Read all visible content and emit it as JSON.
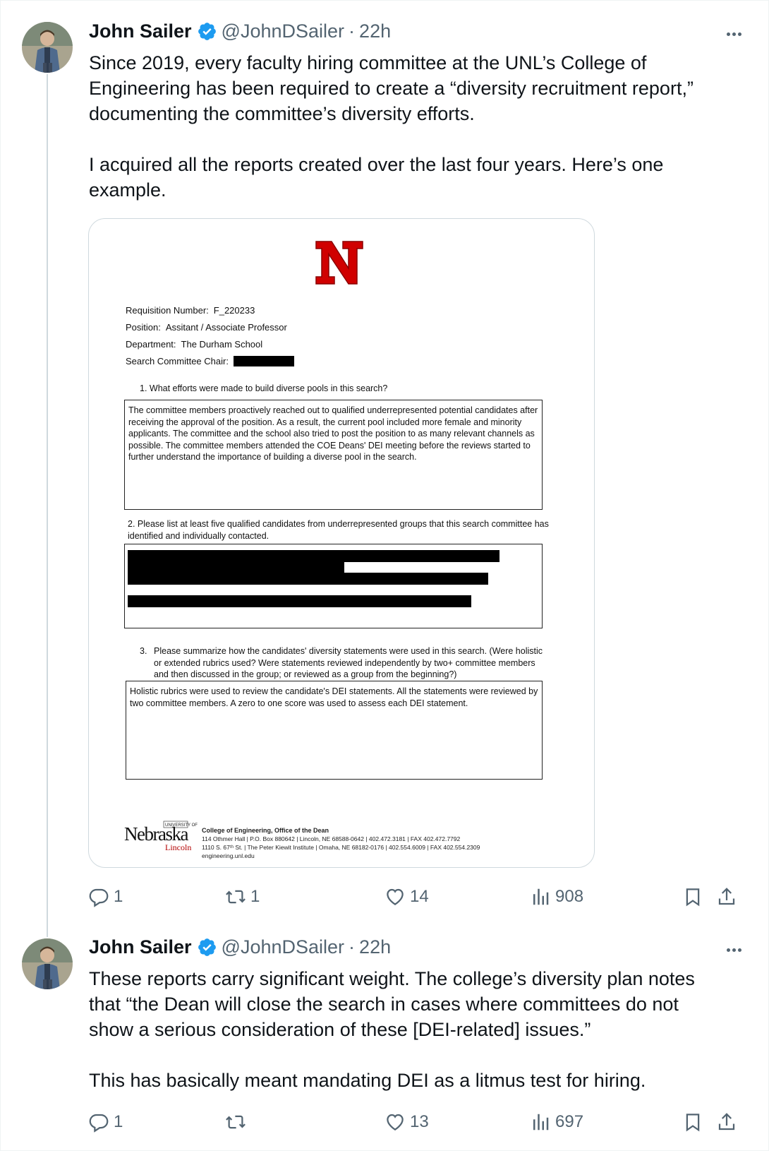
{
  "tweets": [
    {
      "author": "John Sailer",
      "handle": "@JohnDSailer",
      "separator": "·",
      "time": "22h",
      "text": "Since 2019, every faculty hiring committee at the UNL’s College of Engineering has been required to create a “diversity recruitment report,” documenting the committee’s diversity efforts.\n\nI acquired all the reports created over the last four years. Here’s one example.",
      "stats": {
        "replies": "1",
        "reposts": "1",
        "likes": "14",
        "views": "908"
      }
    },
    {
      "author": "John Sailer",
      "handle": "@JohnDSailer",
      "separator": "·",
      "time": "22h",
      "text": "These reports carry significant weight. The college’s diversity plan notes that “the Dean will close the search in cases where committees do not show a serious consideration of these [DEI-related] issues.”\n\nThis has basically meant mandating DEI as a litmus test for hiring.",
      "stats": {
        "replies": "1",
        "reposts": "",
        "likes": "13",
        "views": "697"
      }
    }
  ],
  "document": {
    "logo_letter": "N",
    "requisition_label": "Requisition Number:",
    "requisition_value": "F_220233",
    "position_label": "Position:",
    "position_value": "Assitant / Associate Professor",
    "department_label": "Department:",
    "department_value": "The Durham School",
    "chair_label": "Search Committee Chair:",
    "q1": "1.   What efforts were made to build diverse pools in this search?",
    "a1": "The committee members proactively reached out to qualified underrepresented potential candidates after receiving the approval of the position. As a result, the current pool included more female and minority applicants. The committee and the school also tried to post the position to as many relevant channels as possible. The committee members attended the COE Deans' DEI meeting before the reviews started to further understand the importance of building a diverse pool in the search.",
    "q2": "2. Please list at least five qualified candidates from underrepresented groups that this search committee has identified and individually contacted.",
    "q3": "Please summarize how the candidates' diversity statements were used in this search.  (Were holistic or extended rubrics used?  Were statements reviewed independently by two+ committee members and then discussed in the group; or reviewed as a group from the beginning?)",
    "q3_num": "3.",
    "a3": "Holistic rubrics were used to review the candidate's DEI statements. All the statements were reviewed by two committee members. A zero to one score was used to assess each DEI statement.",
    "footer_university": "UNIVERSITY OF",
    "footer_nebraska": "Nebraska",
    "footer_lincoln": "Lincoln",
    "footer_title": "College of Engineering, Office of the Dean",
    "footer_line1": "114 Othmer Hall  |  P.O. Box 880642  |  Lincoln, NE 68588-0642  |  402.472.3181  |  FAX 402.472.7792",
    "footer_line2": "1110 S. 67ᵗʰ St.  |  The Peter Kiewit Institute  |  Omaha, NE 68182-0176  |  402.554.6009  |  FAX 402.554.2309",
    "footer_line3": "engineering.unl.edu"
  },
  "colors": {
    "verified": "#1d9bf0",
    "nebraska_red": "#d00000",
    "muted": "#536471"
  },
  "icons": [
    "verified-badge-icon",
    "more-icon",
    "reply-icon",
    "repost-icon",
    "like-icon",
    "views-icon",
    "bookmark-icon",
    "share-icon"
  ]
}
